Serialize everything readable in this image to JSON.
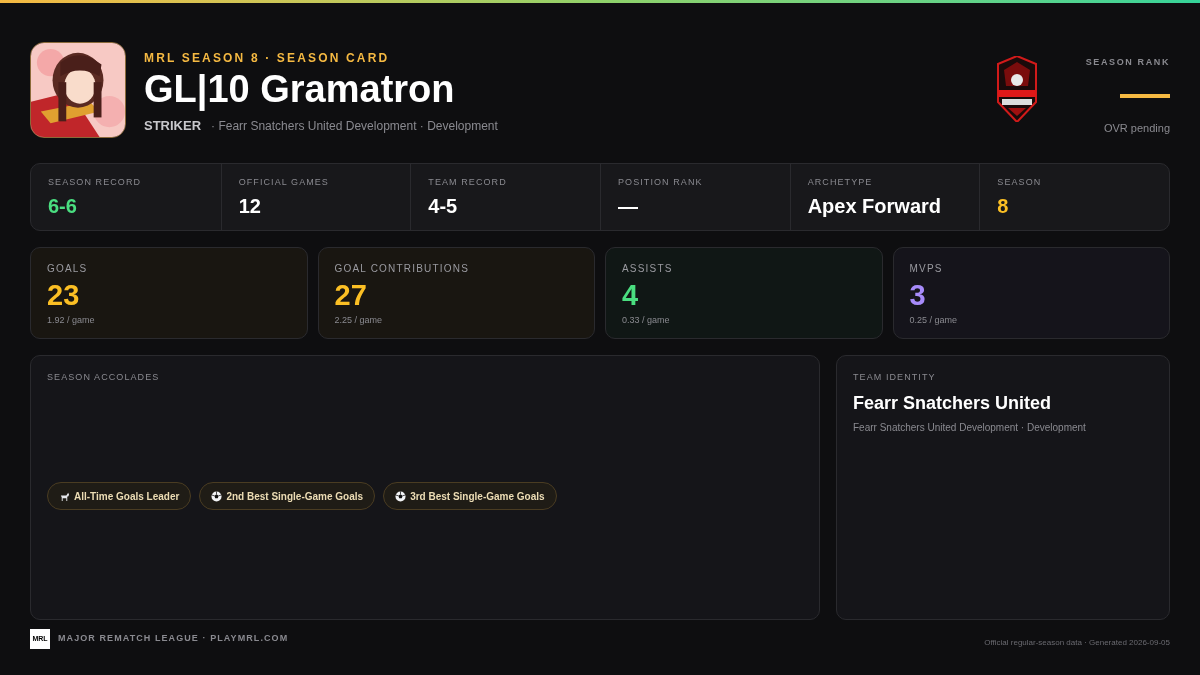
{
  "header": {
    "eyebrow": "MRL SEASON 8 · SEASON CARD",
    "player_name": "GL|10 Gramatron",
    "position": "STRIKER",
    "team_line": "· Fearr Snatchers United Development · Development",
    "rank_label": "SEASON RANK",
    "rank_note": "OVR pending"
  },
  "summary": [
    {
      "label": "SEASON RECORD",
      "value": "6-6",
      "color": "#4ade80"
    },
    {
      "label": "OFFICIAL GAMES",
      "value": "12",
      "color": "#ffffff"
    },
    {
      "label": "TEAM RECORD",
      "value": "4-5",
      "color": "#ffffff"
    },
    {
      "label": "POSITION RANK",
      "value": "—",
      "color": "#ffffff"
    },
    {
      "label": "ARCHETYPE",
      "value": "Apex Forward",
      "color": "#ffffff"
    },
    {
      "label": "SEASON",
      "value": "8",
      "color": "#fbbf24"
    }
  ],
  "stat_cards": [
    {
      "label": "GOALS",
      "value": "23",
      "per_game": "1.92 / game",
      "color": "#fbbf24"
    },
    {
      "label": "GOAL CONTRIBUTIONS",
      "value": "27",
      "per_game": "2.25 / game",
      "color": "#fbbf24"
    },
    {
      "label": "ASSISTS",
      "value": "4",
      "per_game": "0.33 / game",
      "color": "#4ade80"
    },
    {
      "label": "MVPS",
      "value": "3",
      "per_game": "0.25 / game",
      "color": "#a78bfa"
    }
  ],
  "accolades": {
    "title": "SEASON ACCOLADES",
    "items": [
      {
        "kind": "goat",
        "label": "All-Time Goals Leader"
      },
      {
        "kind": "ball",
        "label": "2nd Best Single-Game Goals"
      },
      {
        "kind": "ball",
        "label": "3rd Best Single-Game Goals"
      }
    ]
  },
  "team_identity": {
    "title": "TEAM IDENTITY",
    "team": "Fearr Snatchers United",
    "subtitle": "Fearr Snatchers United Development · Development"
  },
  "footer": {
    "logo": "MRL",
    "league": "MAJOR REMATCH LEAGUE · PLAYMRL.COM",
    "note": "Official regular-season data · Generated 2026-09-05"
  }
}
